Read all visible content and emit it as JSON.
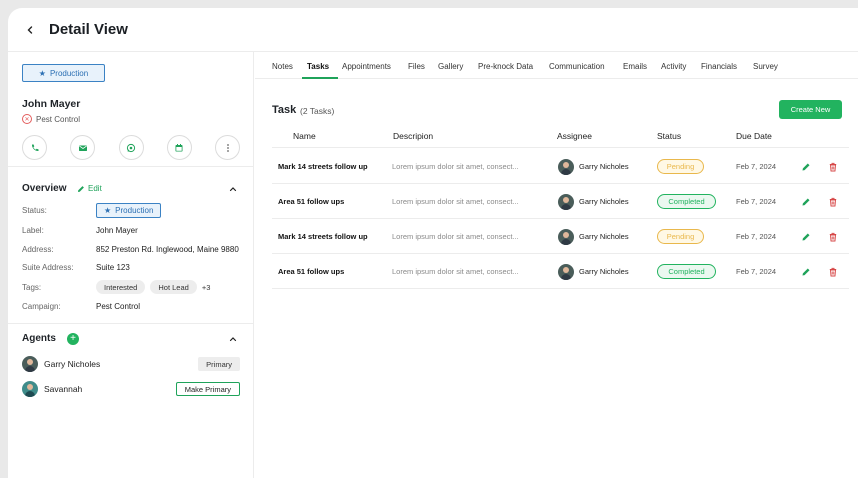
{
  "header": {
    "title": "Detail View"
  },
  "contact": {
    "status": "Production",
    "name": "John Mayer",
    "type": "Pest Control",
    "actions": [
      "phone-icon",
      "email-icon",
      "chat-icon",
      "calendar-icon",
      "more-icon"
    ]
  },
  "overview": {
    "title": "Overview",
    "edit_label": "Edit",
    "rows": {
      "status_label": "Status:",
      "status_value": "Production",
      "label_label": "Label:",
      "label_value": "John Mayer",
      "address_label": "Address:",
      "address_value": "852 Preston Rd. Inglewood, Maine 9880",
      "suite_label": "Suite Address:",
      "suite_value": "Suite 123",
      "tags_label": "Tags:",
      "tags": [
        "Interested",
        "Hot Lead"
      ],
      "tags_more": "+3",
      "campaign_label": "Campaign:",
      "campaign_value": "Pest Control"
    }
  },
  "agents": {
    "title": "Agents",
    "list": [
      {
        "name": "Garry Nicholes",
        "badge": "Primary"
      },
      {
        "name": "Savannah",
        "badge": "Make Primary"
      }
    ]
  },
  "tabs": [
    "Notes",
    "Tasks",
    "Appointments",
    "Files",
    "Gallery",
    "Pre-knock Data",
    "Communication",
    "Emails",
    "Activity",
    "Financials",
    "Survey"
  ],
  "active_tab": "Tasks",
  "tasks": {
    "title": "Task",
    "count": "(2 Tasks)",
    "create_label": "Create New",
    "columns": [
      "Name",
      "Descripion",
      "Assignee",
      "Status",
      "Due Date"
    ],
    "rows": [
      {
        "name": "Mark 14 streets follow up",
        "desc": "Lorem ipsum dolor sit amet, consect...",
        "assignee": "Garry Nicholes",
        "status": "Pending",
        "due": "Feb 7, 2024"
      },
      {
        "name": "Area 51 follow ups",
        "desc": "Lorem ipsum dolor sit amet, consect...",
        "assignee": "Garry Nicholes",
        "status": "Completed",
        "due": "Feb 7, 2024"
      },
      {
        "name": "Mark 14 streets follow up",
        "desc": "Lorem ipsum dolor sit amet, consect...",
        "assignee": "Garry Nicholes",
        "status": "Pending",
        "due": "Feb 7, 2024"
      },
      {
        "name": "Area 51 follow ups",
        "desc": "Lorem ipsum dolor sit amet, consect...",
        "assignee": "Garry Nicholes",
        "status": "Completed",
        "due": "Feb 7, 2024"
      }
    ]
  },
  "colors": {
    "accent": "#22b35f",
    "pending": "#e9b84c",
    "delete": "#d64545",
    "info": "#2b6fb3"
  }
}
